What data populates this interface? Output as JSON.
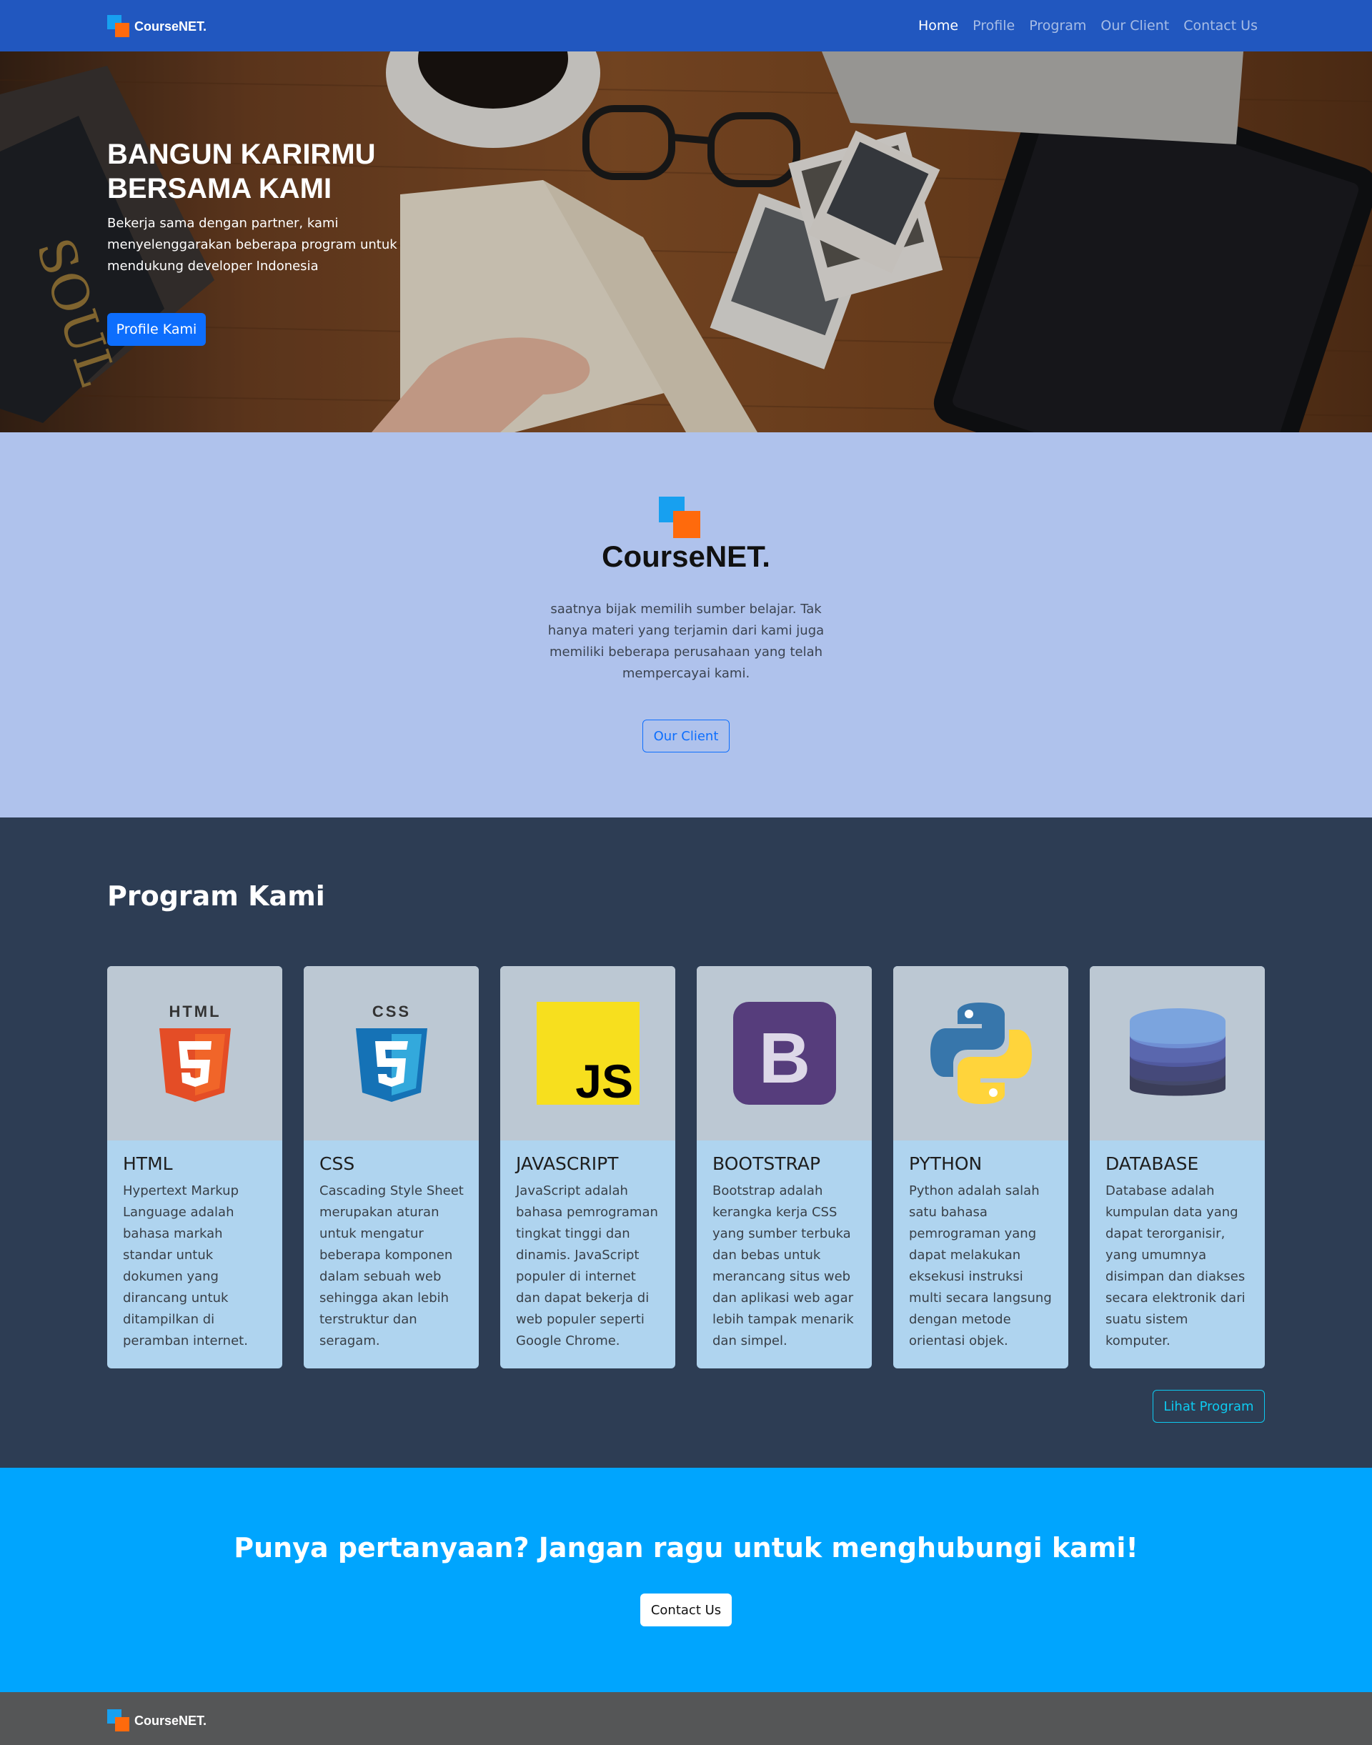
{
  "navbar": {
    "brand": "CourseNET.",
    "links": [
      {
        "label": "Home"
      },
      {
        "label": "Profile"
      },
      {
        "label": "Program"
      },
      {
        "label": "Our Client"
      },
      {
        "label": "Contact Us"
      }
    ]
  },
  "hero": {
    "title": "BANGUN KARIRMU BERSAMA KAMI",
    "text": "Bekerja sama dengan partner, kami menyelenggarakan beberapa program untuk mendukung developer Indonesia",
    "button_label": "Profile Kami"
  },
  "about": {
    "brand": "CourseNET.",
    "text": "saatnya bijak memilih sumber belajar. Tak hanya materi yang terjamin dari kami juga memiliki beberapa perusahaan yang telah mempercayai kami.",
    "button_label": "Our Client"
  },
  "program": {
    "title": "Program Kami",
    "cards": [
      {
        "title": "HTML",
        "icon": "html5-icon",
        "text": "Hypertext Markup Language adalah bahasa markah standar untuk dokumen yang dirancang untuk ditampilkan di peramban internet."
      },
      {
        "title": "CSS",
        "icon": "css3-icon",
        "text": "Cascading Style Sheet merupakan aturan untuk mengatur beberapa komponen dalam sebuah web sehingga akan lebih terstruktur dan seragam."
      },
      {
        "title": "JAVASCRIPT",
        "icon": "javascript-icon",
        "text": "JavaScript adalah bahasa pemrograman tingkat tinggi dan dinamis. JavaScript populer di internet dan dapat bekerja di web populer seperti Google Chrome."
      },
      {
        "title": "BOOTSTRAP",
        "icon": "bootstrap-icon",
        "text": "Bootstrap adalah kerangka kerja CSS yang sumber terbuka dan bebas untuk merancang situs web dan aplikasi web agar lebih tampak menarik dan simpel."
      },
      {
        "title": "PYTHON",
        "icon": "python-icon",
        "text": "Python adalah salah satu bahasa pemrograman yang dapat melakukan eksekusi instruksi multi secara langsung dengan metode orientasi objek."
      },
      {
        "title": "DATABASE",
        "icon": "database-icon",
        "text": "Database adalah kumpulan data yang dapat terorganisir, yang umumnya disimpan dan diakses secara elektronik dari suatu sistem komputer."
      }
    ],
    "button_label": "Lihat Program"
  },
  "contact": {
    "title": "Punya pertanyaan? Jangan ragu untuk menghubungi kami!",
    "button_label": "Contact Us"
  },
  "footer": {
    "brand": "CourseNET."
  },
  "colors": {
    "navbar": "#2157bf",
    "about_bg": "#afc2ec",
    "program_bg": "#2d3d54",
    "contact_bg": "#00a5fe",
    "footer_bg": "#555657",
    "primary": "#0d6efd",
    "logo_blue": "#17a0f0",
    "logo_orange": "#ff6a0c"
  }
}
